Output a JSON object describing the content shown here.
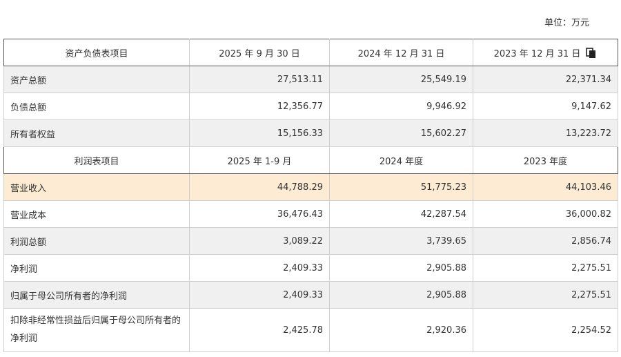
{
  "unit_label": "单位：万元",
  "balance_header": [
    "资产负债表项目",
    "2025 年 9 月 30 日",
    "2024 年 12 月 31 日",
    "2023 年 12 月 31 日"
  ],
  "balance_rows": [
    {
      "label": "资产总额",
      "values": [
        "27,513.11",
        "25,549.19",
        "22,371.34"
      ]
    },
    {
      "label": "负债总额",
      "values": [
        "12,356.77",
        "9,946.92",
        "9,147.62"
      ]
    },
    {
      "label": "所有者权益",
      "values": [
        "15,156.33",
        "15,602.27",
        "13,223.72"
      ]
    }
  ],
  "income_header": [
    "利润表项目",
    "2025 年 1-9 月",
    "2024 年度",
    "2023 年度"
  ],
  "income_rows": [
    {
      "label": "营业收入",
      "values": [
        "44,788.29",
        "51,775.23",
        "44,103.46"
      ]
    },
    {
      "label": "营业成本",
      "values": [
        "36,476.43",
        "42,287.54",
        "36,000.82"
      ]
    },
    {
      "label": "利润总额",
      "values": [
        "3,089.22",
        "3,739.65",
        "2,856.74"
      ]
    },
    {
      "label": "净利润",
      "values": [
        "2,409.33",
        "2,905.88",
        "2,275.51"
      ]
    },
    {
      "label": "归属于母公司所有者的净利润",
      "values": [
        "2,409.33",
        "2,905.88",
        "2,275.51"
      ]
    },
    {
      "label": "扣除非经常性损益后归属于母公司所有者的净利润",
      "values": [
        "2,425.78",
        "2,920.36",
        "2,254.52"
      ]
    }
  ],
  "icons": {
    "copy": "copy-icon"
  },
  "colors": {
    "highlight_row": "#fdebd3",
    "stripe": "#f0f0f0"
  }
}
